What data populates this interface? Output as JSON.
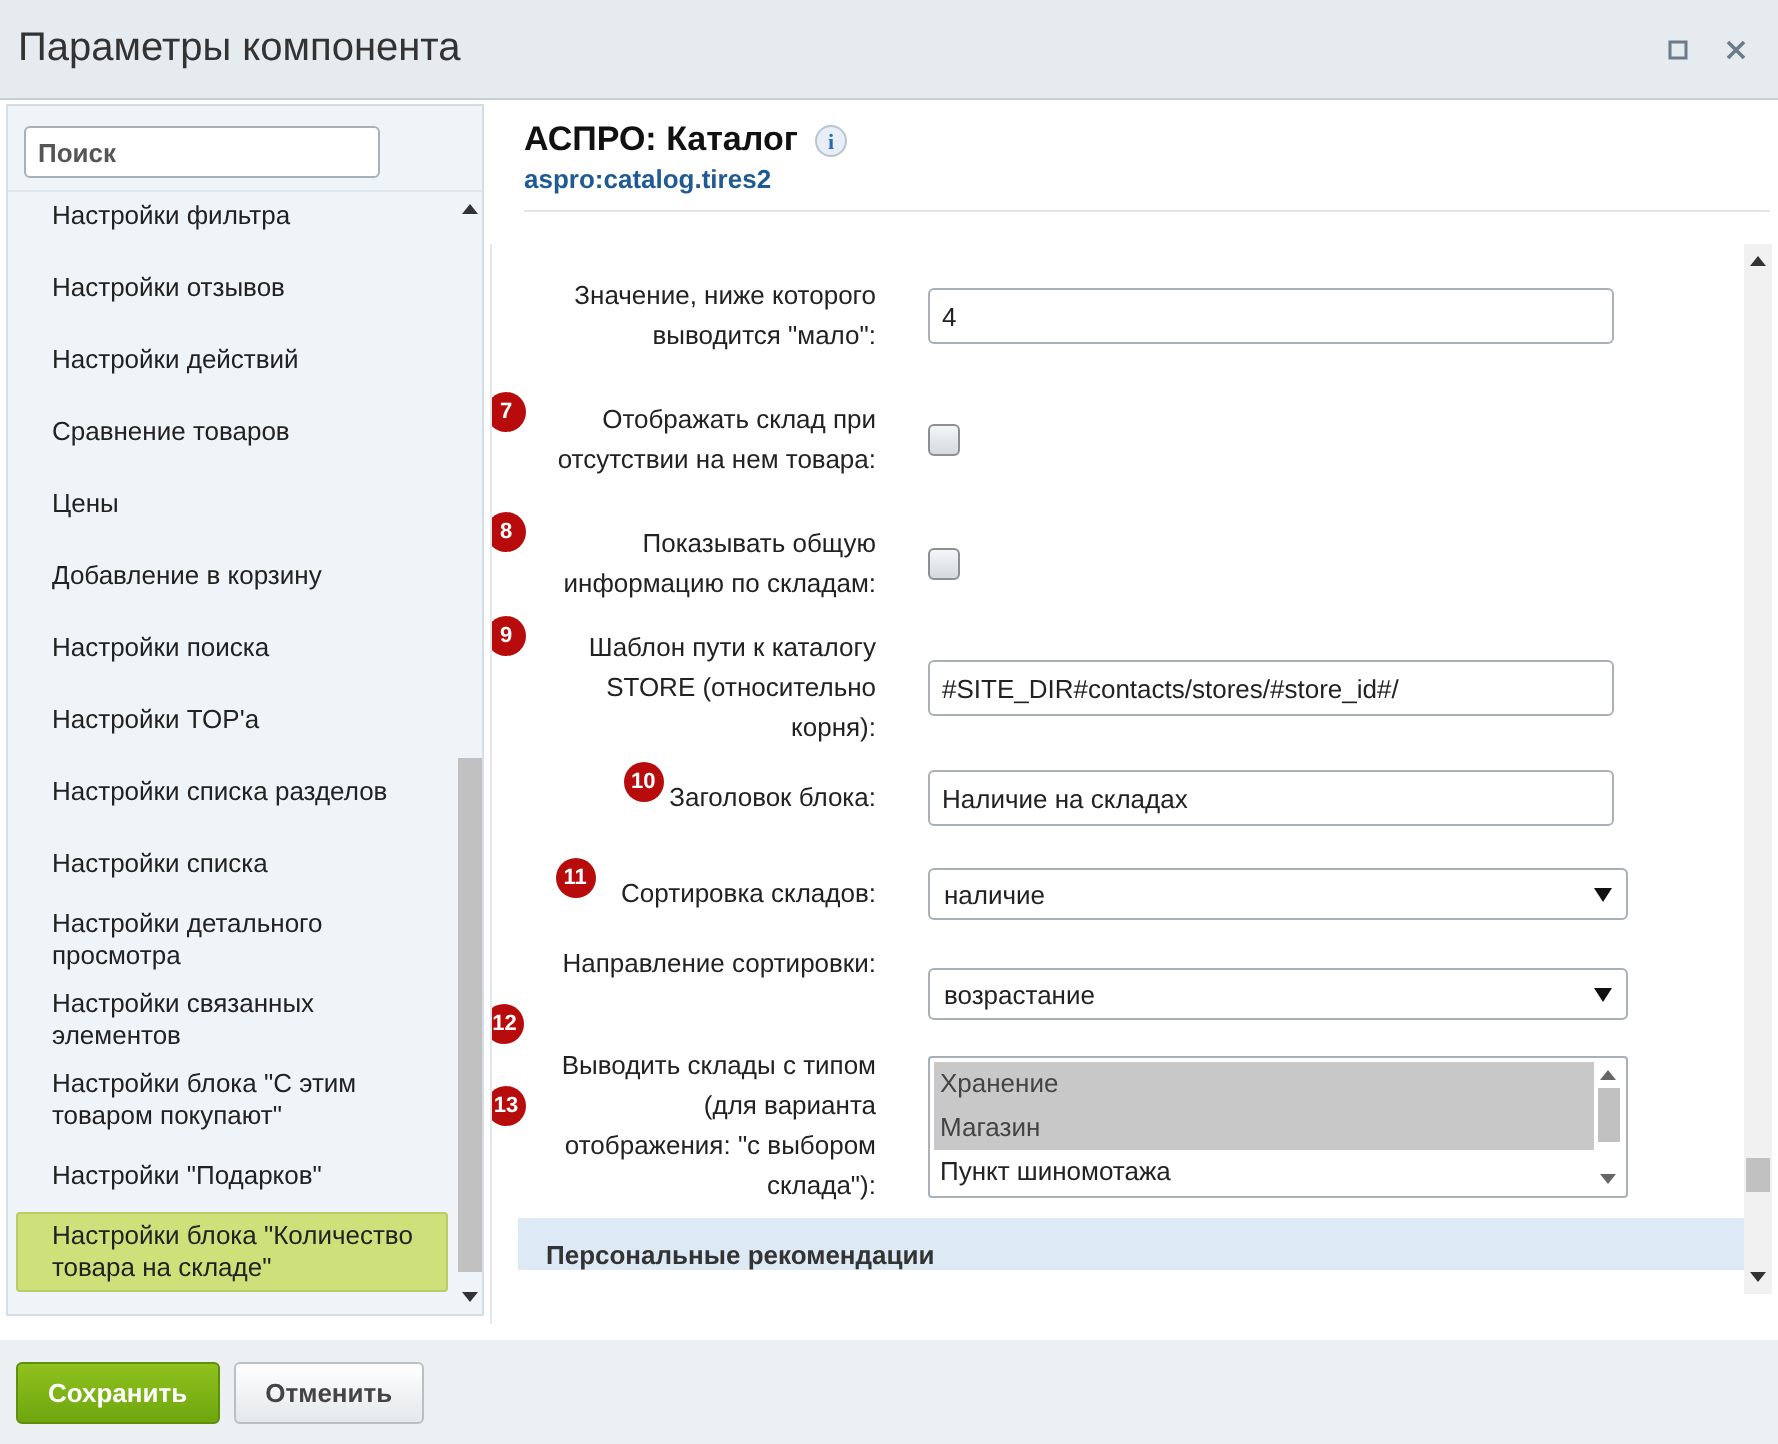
{
  "window": {
    "title": "Параметры компонента"
  },
  "sidebar": {
    "search": {
      "placeholder": "Поиск"
    },
    "items": [
      {
        "label": "Настройки фильтра",
        "selected": false
      },
      {
        "label": "Настройки отзывов",
        "selected": false
      },
      {
        "label": "Настройки действий",
        "selected": false
      },
      {
        "label": "Сравнение товаров",
        "selected": false
      },
      {
        "label": "Цены",
        "selected": false
      },
      {
        "label": "Добавление в корзину",
        "selected": false
      },
      {
        "label": "Настройки поиска",
        "selected": false
      },
      {
        "label": "Настройки TOP'а",
        "selected": false
      },
      {
        "label": "Настройки списка разделов",
        "selected": false
      },
      {
        "label": "Настройки списка",
        "selected": false
      },
      {
        "label": "Настройки детального просмотра",
        "selected": false
      },
      {
        "label": "Настройки связанных элементов",
        "selected": false
      },
      {
        "label": "Настройки блока \"С этим товаром покупают\"",
        "selected": false
      },
      {
        "label": "Настройки \"Подарков\"",
        "selected": false
      },
      {
        "label": "Настройки блока \"Количество товара на складе\"",
        "selected": true
      }
    ]
  },
  "component": {
    "title": "АСПРО: Каталог",
    "code": "aspro:catalog.tires2",
    "info_icon": "i"
  },
  "fields": [
    {
      "kind": "input",
      "label": "Значение, ниже которого выводится \"мало\":",
      "value": "4"
    },
    {
      "kind": "checkbox",
      "badge": "7",
      "label": "Отображать склад при отсутствии на нем товара:",
      "checked": false
    },
    {
      "kind": "checkbox",
      "badge": "8",
      "label": "Показывать общую информацию по складам:",
      "checked": false
    },
    {
      "kind": "input",
      "badge": "9",
      "label": "Шаблон пути к каталогу STORE (относительно корня):",
      "value": "#SITE_DIR#contacts/stores/#store_id#/"
    },
    {
      "kind": "input",
      "badge": "10",
      "label": "Заголовок блока:",
      "value": "Наличие на складах"
    },
    {
      "kind": "select",
      "badge": "11",
      "label": "Сортировка складов:",
      "value": "наличие"
    },
    {
      "kind": "select",
      "badge": "12",
      "label": "Направление сортировки:",
      "value": "возрастание"
    },
    {
      "kind": "multiselect",
      "badge": "13",
      "label": "Выводить склады с типом (для варианта отображения: \"с выбором склада\"):",
      "options": [
        {
          "label": "Хранение",
          "selected": true
        },
        {
          "label": "Магазин",
          "selected": true
        },
        {
          "label": "Пункт шиномотажа",
          "selected": false
        }
      ]
    }
  ],
  "section": {
    "title": "Персональные рекомендации"
  },
  "buttons": [
    {
      "kind": "primary",
      "label": "Сохранить"
    },
    {
      "kind": "secondary",
      "label": "Отменить"
    }
  ]
}
